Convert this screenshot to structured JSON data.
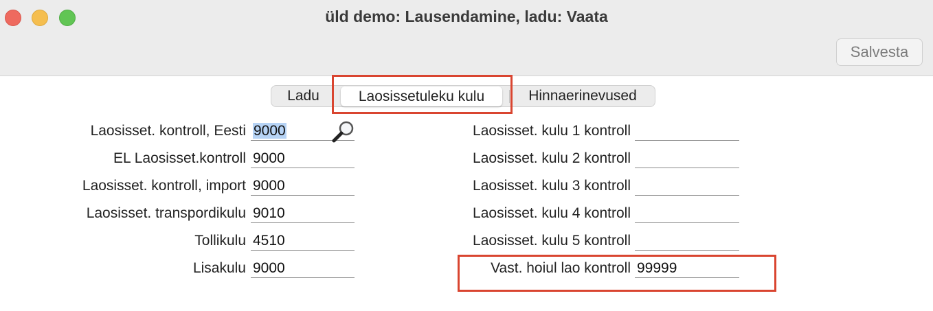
{
  "window": {
    "title": "üld demo: Lausendamine, ladu: Vaata"
  },
  "toolbar": {
    "save_label": "Salvesta"
  },
  "tabs": [
    {
      "label": "Ladu",
      "active": false
    },
    {
      "label": "Laosissetuleku kulu",
      "active": true
    },
    {
      "label": "Hinnaerinevused",
      "active": false
    }
  ],
  "left_fields": [
    {
      "label": "Laosisset. kontroll, Eesti",
      "value": "9000"
    },
    {
      "label": "EL Laosisset.kontroll",
      "value": "9000"
    },
    {
      "label": "Laosisset. kontroll, import",
      "value": "9000"
    },
    {
      "label": "Laosisset. transpordikulu",
      "value": "9010"
    },
    {
      "label": "Tollikulu",
      "value": "4510"
    },
    {
      "label": "Lisakulu",
      "value": "9000"
    }
  ],
  "right_fields": [
    {
      "label": "Laosisset. kulu 1 kontroll",
      "value": ""
    },
    {
      "label": "Laosisset. kulu 2 kontroll",
      "value": ""
    },
    {
      "label": "Laosisset. kulu 3 kontroll",
      "value": ""
    },
    {
      "label": "Laosisset. kulu 4 kontroll",
      "value": ""
    },
    {
      "label": "Laosisset. kulu 5 kontroll",
      "value": ""
    },
    {
      "label": "Vast. hoiul lao kontroll",
      "value": "99999"
    }
  ],
  "colors": {
    "highlight": "#d94530",
    "selection": "#b6d3f5"
  }
}
